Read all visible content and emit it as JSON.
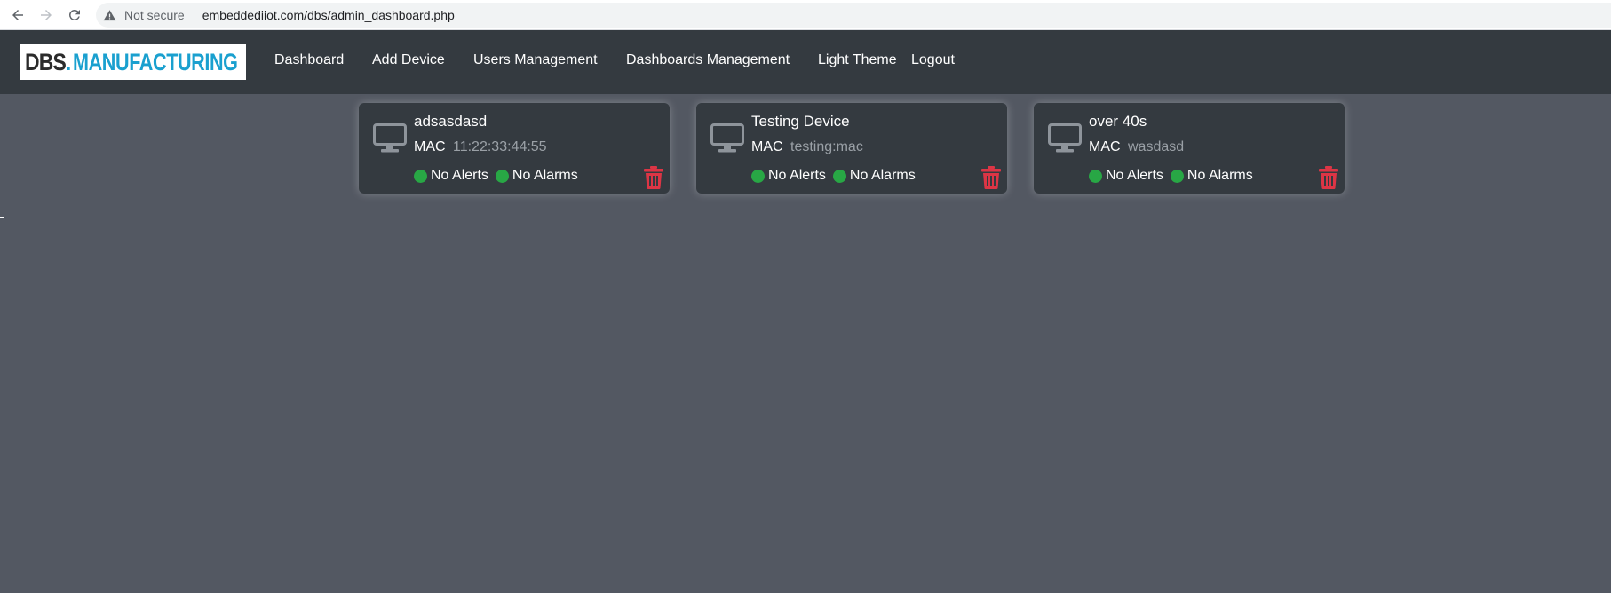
{
  "browser": {
    "security_label": "Not secure",
    "url": "embeddediiot.com/dbs/admin_dashboard.php"
  },
  "logo": {
    "part1": "DBS",
    "dot": ".",
    "part2": "MANUFACTURING"
  },
  "nav": {
    "items": [
      {
        "label": "Dashboard"
      },
      {
        "label": "Add Device"
      },
      {
        "label": "Users Management"
      },
      {
        "label": "Dashboards Management"
      },
      {
        "label": "Light Theme"
      },
      {
        "label": "Logout"
      }
    ]
  },
  "devices": [
    {
      "name": "adsasdasd",
      "mac_label": "MAC",
      "mac": "11:22:33:44:55",
      "alerts": "No Alerts",
      "alarms": "No Alarms"
    },
    {
      "name": "Testing Device",
      "mac_label": "MAC",
      "mac": "testing:mac",
      "alerts": "No Alerts",
      "alarms": "No Alarms"
    },
    {
      "name": "over 40s",
      "mac_label": "MAC",
      "mac": "wasdasd",
      "alerts": "No Alerts",
      "alarms": "No Alarms"
    }
  ],
  "colors": {
    "page_bg": "#535862",
    "navbar_bg": "#343a40",
    "card_bg": "#343a40",
    "status_ok": "#28a745",
    "delete": "#dc3545",
    "logo_accent": "#1aa0cf"
  }
}
